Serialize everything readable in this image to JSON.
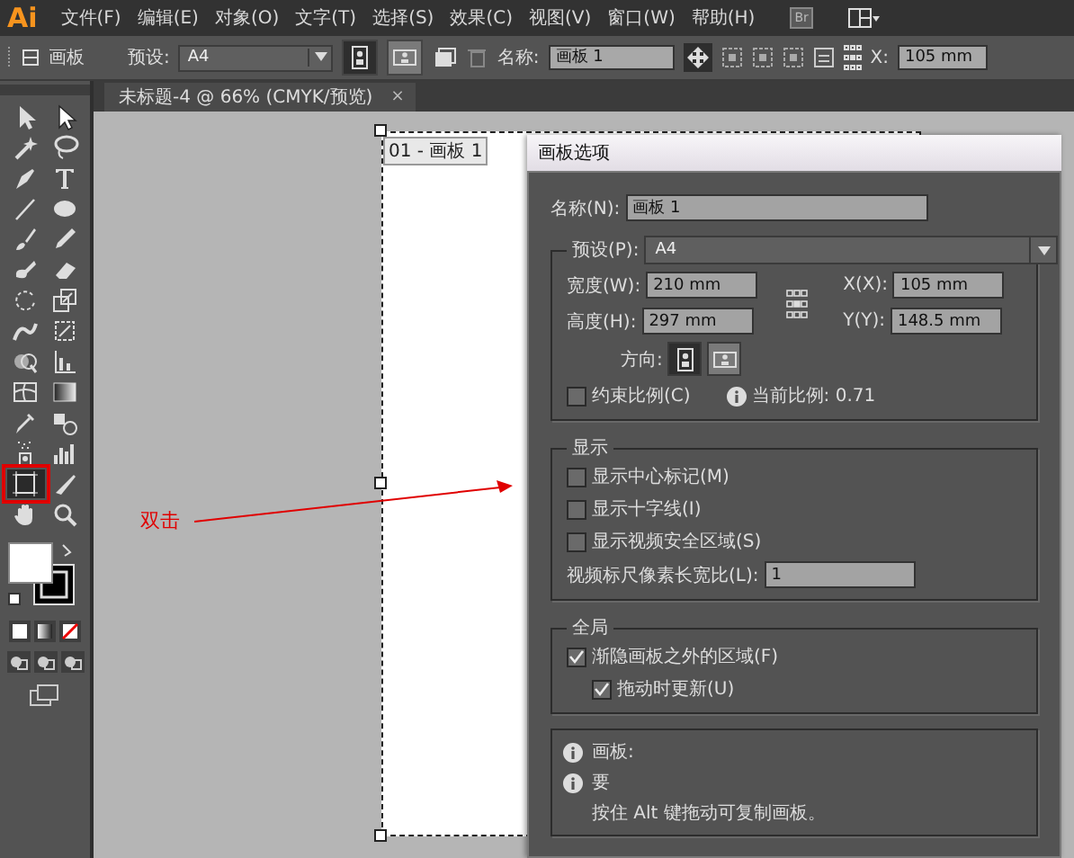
{
  "menubar": {
    "logo": "Ai",
    "items": [
      "文件(F)",
      "编辑(E)",
      "对象(O)",
      "文字(T)",
      "选择(S)",
      "效果(C)",
      "视图(V)",
      "窗口(W)",
      "帮助(H)"
    ],
    "bridge": "Br"
  },
  "controlbar": {
    "label": "画板",
    "preset_label": "预设:",
    "preset": "A4",
    "orientation": [
      {
        "kind": "portrait",
        "selected": true
      },
      {
        "kind": "landscape",
        "selected": false
      }
    ],
    "name_label": "名称:",
    "name": "画板 1",
    "x_label": "X:",
    "x": "105 mm"
  },
  "tools": [
    {
      "kind": "selection",
      "selected": false
    },
    {
      "kind": "direct-selection",
      "selected": false
    },
    {
      "kind": "magic-wand",
      "selected": false
    },
    {
      "kind": "lasso",
      "selected": false
    },
    {
      "kind": "pen",
      "selected": false
    },
    {
      "kind": "type",
      "selected": false
    },
    {
      "kind": "line",
      "selected": false
    },
    {
      "kind": "ellipse",
      "selected": false
    },
    {
      "kind": "brush",
      "selected": false
    },
    {
      "kind": "pencil",
      "selected": false
    },
    {
      "kind": "blob-brush",
      "selected": false
    },
    {
      "kind": "eraser",
      "selected": false
    },
    {
      "kind": "rotate",
      "selected": false
    },
    {
      "kind": "scale",
      "selected": false
    },
    {
      "kind": "warp",
      "selected": false
    },
    {
      "kind": "free-transform",
      "selected": false
    },
    {
      "kind": "shape-builder",
      "selected": false
    },
    {
      "kind": "graph",
      "selected": false
    },
    {
      "kind": "mesh",
      "selected": false
    },
    {
      "kind": "gradient",
      "selected": false
    },
    {
      "kind": "eyedropper",
      "selected": false
    },
    {
      "kind": "blend",
      "selected": false
    },
    {
      "kind": "sprayer",
      "selected": false
    },
    {
      "kind": "column-graph",
      "selected": false
    },
    {
      "kind": "artboard",
      "selected": true
    },
    {
      "kind": "slice",
      "selected": false
    },
    {
      "kind": "hand",
      "selected": false
    },
    {
      "kind": "zoom",
      "selected": false
    }
  ],
  "document_tab": {
    "title": "未标题-4 @ 66% (CMYK/预览)",
    "close": "×"
  },
  "artboard": {
    "label": "01 - 画板 1"
  },
  "annotation": {
    "text": "双击"
  },
  "dialog": {
    "title": "画板选项",
    "name_label": "名称(N):",
    "name": "画板 1",
    "preset_label": "预设(P):",
    "preset": "A4",
    "width_label": "宽度(W):",
    "width": "210 mm",
    "height_label": "高度(H):",
    "height": "297 mm",
    "x_label": "X(X):",
    "x": "105 mm",
    "y_label": "Y(Y):",
    "y": "148.5 mm",
    "orientation_label": "方向:",
    "orientation": [
      {
        "kind": "portrait",
        "selected": true
      },
      {
        "kind": "landscape",
        "selected": false
      }
    ],
    "constrain": {
      "label": "约束比例(C)",
      "checked": false
    },
    "ratio": "当前比例: 0.71",
    "display": {
      "title": "显示",
      "options": [
        {
          "label": "显示中心标记(M)",
          "checked": false
        },
        {
          "label": "显示十字线(I)",
          "checked": false
        },
        {
          "label": "显示视频安全区域(S)",
          "checked": false
        }
      ],
      "ratio_label": "视频标尺像素长宽比(L):",
      "ratio_value": "1"
    },
    "global": {
      "title": "全局",
      "options": [
        {
          "label": "渐隐画板之外的区域(F)",
          "checked": true,
          "children": [
            {
              "label": "拖动时更新(U)",
              "checked": true
            }
          ]
        }
      ]
    },
    "info": [
      {
        "text": "画板:",
        "icon": true
      },
      {
        "text": "要",
        "icon": true
      },
      {
        "text": "按住 Alt 键拖动可复制画板。",
        "icon": false
      }
    ]
  }
}
